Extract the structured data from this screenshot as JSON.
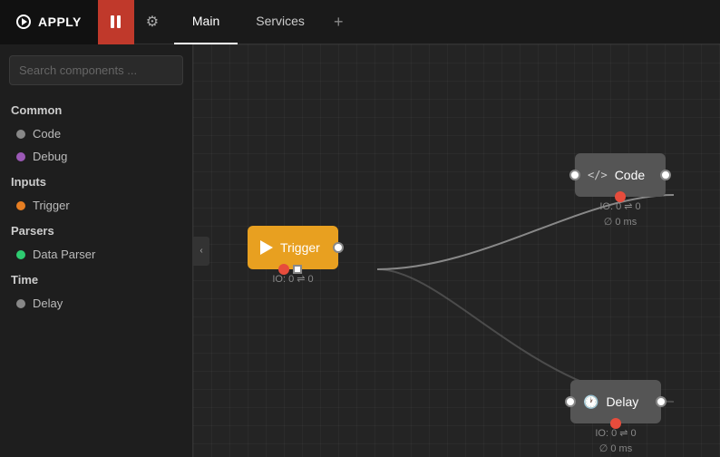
{
  "topbar": {
    "apply_label": "APPLY",
    "tab_main": "Main",
    "tab_services": "Services",
    "tab_add": "+"
  },
  "sidebar": {
    "search_placeholder": "Search components ...",
    "sections": [
      {
        "name": "Common",
        "items": [
          {
            "label": "Code",
            "dot": "gray"
          },
          {
            "label": "Debug",
            "dot": "purple"
          }
        ]
      },
      {
        "name": "Inputs",
        "items": [
          {
            "label": "Trigger",
            "dot": "orange"
          }
        ]
      },
      {
        "name": "Parsers",
        "items": [
          {
            "label": "Data Parser",
            "dot": "green"
          }
        ]
      },
      {
        "name": "Time",
        "items": [
          {
            "label": "Delay",
            "dot": "gray"
          }
        ]
      }
    ]
  },
  "nodes": {
    "trigger": {
      "label": "Trigger",
      "io": "IO: 0 ⇌ 0"
    },
    "code": {
      "label": "Code",
      "io": "IO: 0 ⇌ 0",
      "timing": "∅ 0 ms"
    },
    "delay": {
      "label": "Delay",
      "io": "IO: 0 ⇌ 0",
      "timing": "∅ 0 ms"
    }
  }
}
